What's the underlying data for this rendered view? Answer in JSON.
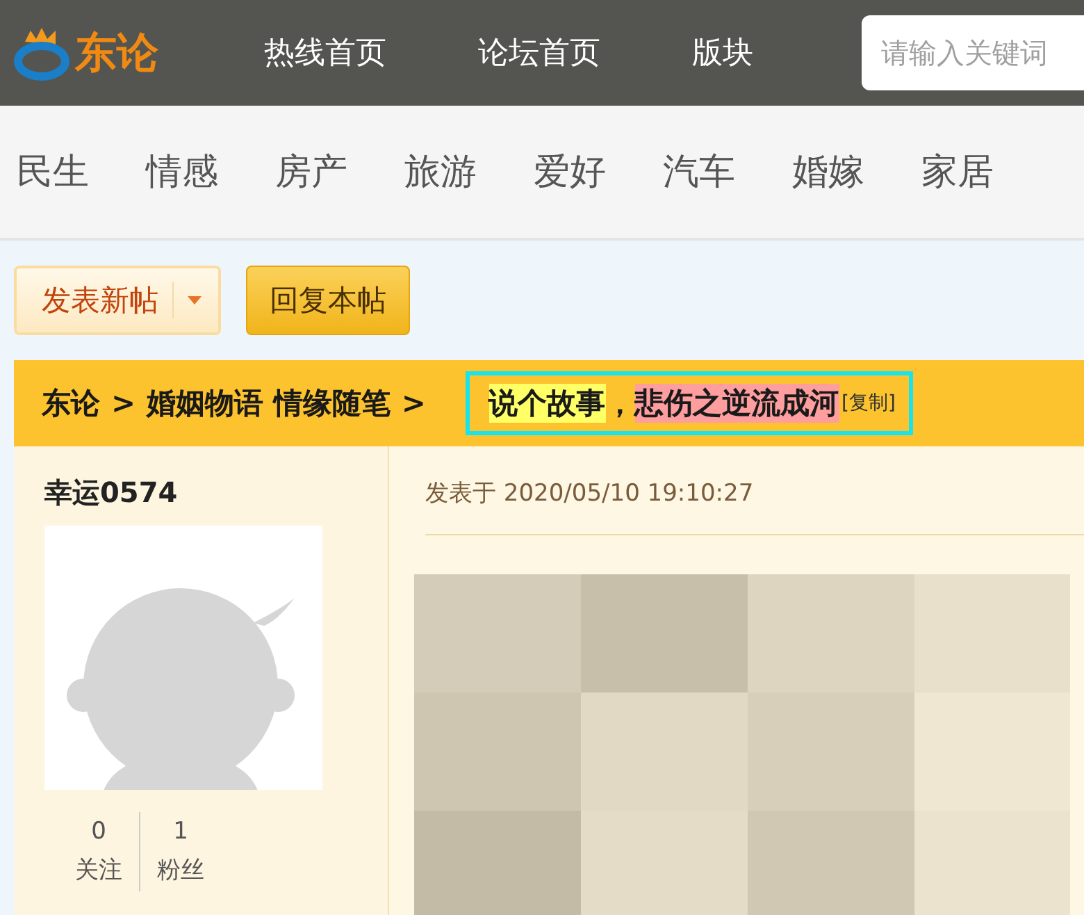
{
  "header": {
    "logo_text": "东论",
    "nav": [
      "热线首页",
      "论坛首页",
      "版块"
    ],
    "search": {
      "placeholder": "请输入关键词"
    }
  },
  "categories": [
    "民生",
    "情感",
    "房产",
    "旅游",
    "爱好",
    "汽车",
    "婚嫁",
    "家居"
  ],
  "actions": {
    "new_post": "发表新帖",
    "reply": "回复本帖"
  },
  "breadcrumb": {
    "items": [
      "东论",
      ">",
      "婚姻物语 情缘随笔",
      ">"
    ],
    "title_segments": [
      {
        "text": "说个故事",
        "color": "#ffff66"
      },
      {
        "text": "，"
      },
      {
        "text": "悲伤之逆流成河",
        "color": "#ff9e9e"
      }
    ],
    "copy": "[复制]"
  },
  "author": {
    "name": "幸运0574",
    "stats": [
      {
        "value": "0",
        "label": "关注"
      },
      {
        "value": "1",
        "label": "粉丝"
      }
    ]
  },
  "post": {
    "date": "发表于 2020/05/10 19:10:27"
  }
}
